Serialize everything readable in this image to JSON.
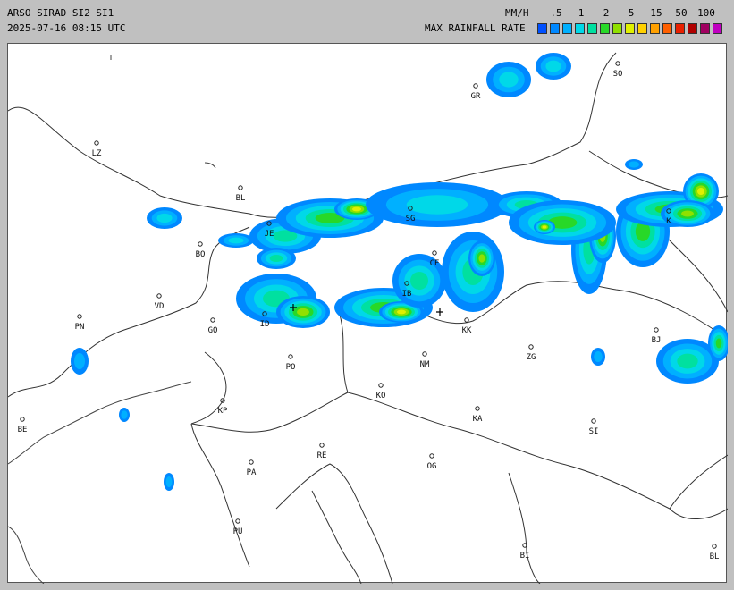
{
  "header": {
    "title": "ARSO SIRAD SI2 SI1",
    "timestamp": "2025-07-16 08:15 UTC",
    "unit": "MM/H",
    "legend_label": "MAX RAINFALL RATE"
  },
  "legend": {
    "ticks": [
      ".5",
      "1",
      "2",
      "5",
      "15",
      "50",
      "100"
    ],
    "colors": [
      "#0050ff",
      "#0088ff",
      "#00b0ff",
      "#00d8e8",
      "#00e0a0",
      "#28d828",
      "#90e000",
      "#e0f000",
      "#ffd000",
      "#ffa000",
      "#ff6000",
      "#e82000",
      "#b00000",
      "#a00060",
      "#c000c0"
    ]
  },
  "map": {
    "cities": [
      {
        "code": "SO"
      },
      {
        "code": "GR"
      },
      {
        "code": "LZ"
      },
      {
        "code": "BL"
      },
      {
        "code": "JE"
      },
      {
        "code": "BO"
      },
      {
        "code": "SG"
      },
      {
        "code": "CE"
      },
      {
        "code": "IB"
      },
      {
        "code": "VD"
      },
      {
        "code": "PN"
      },
      {
        "code": "GO"
      },
      {
        "code": "ID"
      },
      {
        "code": "KK"
      },
      {
        "code": "BJ"
      },
      {
        "code": "PO"
      },
      {
        "code": "NM"
      },
      {
        "code": "ZG"
      },
      {
        "code": "KO"
      },
      {
        "code": "KP"
      },
      {
        "code": "BE"
      },
      {
        "code": "KA"
      },
      {
        "code": "SI"
      },
      {
        "code": "RE"
      },
      {
        "code": "PA"
      },
      {
        "code": "OG"
      },
      {
        "code": "PU"
      },
      {
        "code": "BI"
      },
      {
        "code": "BL"
      },
      {
        "code": "K"
      }
    ]
  }
}
